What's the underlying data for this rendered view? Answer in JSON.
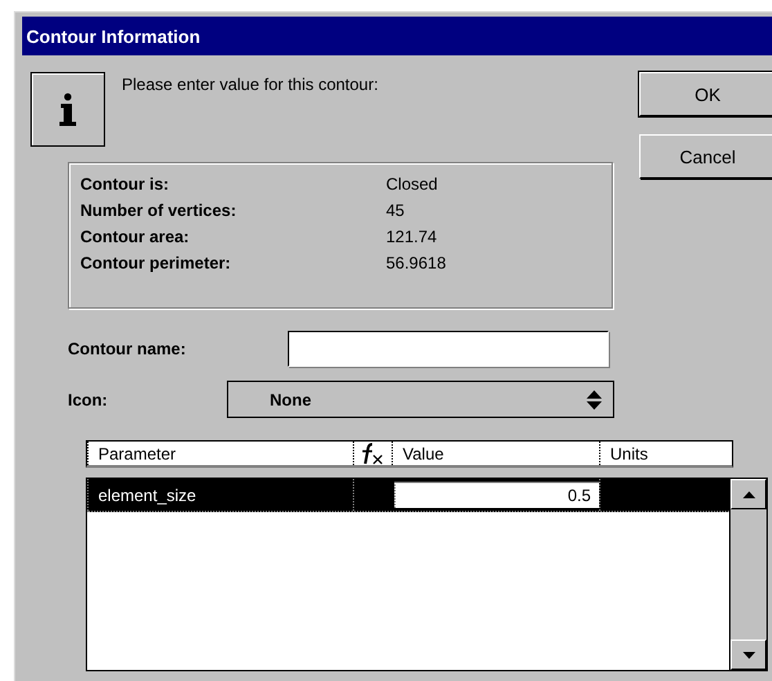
{
  "window": {
    "title": "Contour Information"
  },
  "message": "Please enter value for this contour:",
  "buttons": [
    "OK",
    "Cancel"
  ],
  "info": [
    {
      "label": "Contour is:",
      "value": "Closed"
    },
    {
      "label": "Number of vertices:",
      "value": "45"
    },
    {
      "label": "Contour area:",
      "value": "121.74"
    },
    {
      "label": "Contour perimeter:",
      "value": "56.9618"
    }
  ],
  "name_field": {
    "label": "Contour name:"
  },
  "icon_field": {
    "label": "Icon:",
    "value": "None"
  },
  "table": {
    "columns": [
      {
        "kind": "text",
        "label": "Parameter"
      },
      {
        "kind": "formula"
      },
      {
        "kind": "text",
        "label": "Value"
      },
      {
        "kind": "text",
        "label": "Units"
      }
    ],
    "rows": [
      {
        "parameter": "element_size",
        "value": "0.5",
        "selected": true
      }
    ]
  }
}
